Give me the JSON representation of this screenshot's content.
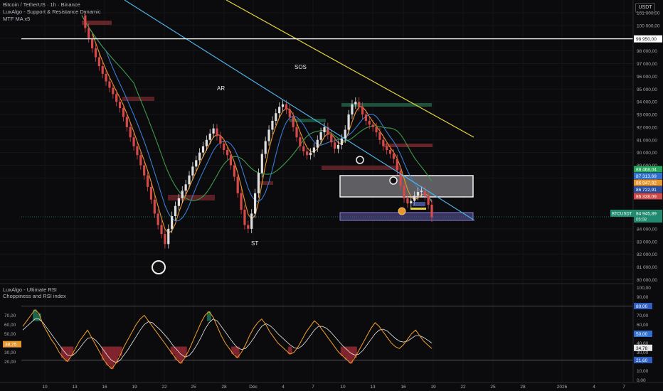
{
  "header": {
    "symbol_line": "Bitcoin / TetherUS · 1h · Binance",
    "indicator_1": "LuxAlgo - Support & Resistance Dynamic",
    "indicator_2": "MTF MA x5",
    "currency": "USDT"
  },
  "annotations": [
    "AR",
    "SOS",
    "ST"
  ],
  "rsi_panel": {
    "title": "LuxAlgo - Ultimate RSI",
    "subtitle": "Choppiness and RSI index"
  },
  "colors": {
    "background": "#0b0b0d",
    "candle_up": "#e0e0e0",
    "candle_down": "#d84a4a",
    "trend_blue": "#4fb3e8",
    "trend_yellow": "#e6d33c",
    "ma_green": "#3d9a4a",
    "ma_orange": "#e8962e",
    "ma_blue": "#3a7bd5",
    "rsi_line": "#f2a02e",
    "rsi_signal": "#e8e8e8",
    "overbought_fill": "#1f7a5a",
    "oversold_fill": "#9c2a35"
  },
  "chart_data": [
    {
      "type": "line",
      "title": "Bitcoin / TetherUS · 1h · Binance",
      "ylabel": "USDT",
      "ylim": [
        79500,
        101500
      ],
      "x_ticks": [
        "10",
        "13",
        "16",
        "19",
        "22",
        "25",
        "28",
        "Déc",
        "4",
        "7",
        "10",
        "13",
        "16",
        "19",
        "22",
        "25",
        "28",
        "2026",
        "4",
        "7"
      ],
      "y_ticks": [
        "101 000,00",
        "100 000,00",
        "99 000,00",
        "98 000,00",
        "97 000,00",
        "96 000,00",
        "95 000,00",
        "94 000,00",
        "93 000,00",
        "92 000,00",
        "91 000,00",
        "90 000,00",
        "89 000,00",
        "88 000,00",
        "84 000,00",
        "83 000,00",
        "82 000,00",
        "81 000,00",
        "80 000,00"
      ],
      "horizontal_level": {
        "value": 98950,
        "label": "98 950,00"
      },
      "price_labels": [
        {
          "value": 88468.04,
          "label": "88 468,04",
          "color": "#26a65b"
        },
        {
          "value": 87313.69,
          "label": "87 313,69",
          "color": "#2f6fd0"
        },
        {
          "value": 86947.92,
          "label": "86 947,92",
          "color": "#e8962e"
        },
        {
          "value": 86722.91,
          "label": "86 722,91",
          "color": "#2a4fa0"
        },
        {
          "value": 86338.09,
          "label": "86 338,09",
          "color": "#d04a4a"
        }
      ],
      "last_price": {
        "symbol": "BTCUSDT",
        "value": 84945.89,
        "label": "84 945,89",
        "countdown": "05:08"
      },
      "series": [
        {
          "name": "BTCUSDT",
          "values": [
            100800,
            99800,
            99000,
            98200,
            97500,
            96800,
            96200,
            95600,
            95100,
            94600,
            94000,
            93500,
            92800,
            92000,
            91200,
            90500,
            89800,
            89000,
            88200,
            87300,
            86300,
            85200,
            84300,
            83600,
            82800,
            84000,
            85000,
            85800,
            86400,
            87000,
            87500,
            88200,
            88900,
            89400,
            90000,
            90500,
            91000,
            91500,
            91900,
            91300,
            90700,
            90200,
            89800,
            89000,
            88100,
            86800,
            85500,
            84300,
            84000,
            85200,
            86800,
            88400,
            89900,
            90900,
            91800,
            92500,
            93100,
            93600,
            93800,
            93400,
            92800,
            92000,
            91200,
            90500,
            90100,
            89800,
            90000,
            90400,
            91000,
            91600,
            92000,
            91400,
            90800,
            90300,
            90600,
            91100,
            91800,
            93000,
            93800,
            94000,
            93600,
            93000,
            92500,
            92200,
            92000,
            91600,
            91000,
            90500,
            90200,
            89900,
            89500,
            88600,
            87400,
            86400,
            86000,
            86200,
            86600,
            86900,
            87000,
            86600,
            85900,
            84900
          ]
        }
      ]
    },
    {
      "type": "line",
      "title": "LuxAlgo - Ultimate RSI",
      "subtitle": "Choppiness and RSI index",
      "ylim": [
        0,
        100
      ],
      "y_ticks": [
        "100,00",
        "90,00",
        "80,00",
        "70,00",
        "60,00",
        "50,00",
        "40,00",
        "30,00",
        "20,00",
        "10,00",
        "0,00"
      ],
      "left_ticks": [
        "70,00",
        "60,00",
        "50,00",
        "40,00",
        "30,00",
        "20,00"
      ],
      "levels": [
        {
          "value": 80,
          "label": "80,00"
        },
        {
          "value": 21.6,
          "label": "21,60"
        }
      ],
      "value_labels": [
        {
          "value": 50,
          "label": "50,00",
          "color": "#2f6fd0"
        },
        {
          "value": 34.78,
          "label": "34,78",
          "color": "#e8e8e8"
        },
        {
          "value": 38.75,
          "label": "38,75",
          "color": "#e8962e"
        }
      ],
      "series": [
        {
          "name": "Ultimate RSI",
          "values": [
            58,
            64,
            70,
            76,
            72,
            60,
            52,
            44,
            38,
            30,
            24,
            20,
            26,
            34,
            42,
            48,
            54,
            46,
            38,
            30,
            22,
            16,
            12,
            18,
            26,
            36,
            44,
            52,
            60,
            66,
            70,
            64,
            58,
            52,
            46,
            40,
            34,
            28,
            22,
            18,
            24,
            32,
            42,
            52,
            62,
            70,
            74,
            68,
            58,
            48,
            40,
            34,
            28,
            24,
            30,
            38,
            48,
            56,
            62,
            66,
            60,
            52,
            46,
            40,
            36,
            32,
            28,
            30,
            36,
            44,
            52,
            58,
            64,
            60,
            54,
            48,
            42,
            36,
            30,
            26,
            22,
            18,
            24,
            32,
            40,
            48,
            56,
            62,
            58,
            52,
            46,
            40,
            36,
            34,
            38,
            44,
            50,
            54,
            48,
            42,
            38,
            34
          ]
        },
        {
          "name": "Signal",
          "values": [
            54,
            58,
            62,
            66,
            66,
            62,
            56,
            50,
            44,
            38,
            32,
            27,
            26,
            29,
            34,
            40,
            45,
            46,
            43,
            38,
            32,
            26,
            21,
            19,
            21,
            27,
            33,
            40,
            47,
            54,
            60,
            63,
            62,
            58,
            54,
            49,
            44,
            38,
            33,
            28,
            25,
            26,
            31,
            38,
            46,
            55,
            62,
            66,
            64,
            58,
            52,
            46,
            40,
            35,
            33,
            34,
            39,
            45,
            52,
            58,
            61,
            59,
            55,
            50,
            46,
            42,
            38,
            35,
            34,
            37,
            42,
            48,
            54,
            58,
            58,
            56,
            52,
            47,
            42,
            37,
            33,
            29,
            27,
            28,
            32,
            38,
            44,
            50,
            54,
            55,
            53,
            49,
            45,
            42,
            41,
            42,
            45,
            48,
            48,
            46,
            43,
            40
          ]
        }
      ]
    }
  ]
}
